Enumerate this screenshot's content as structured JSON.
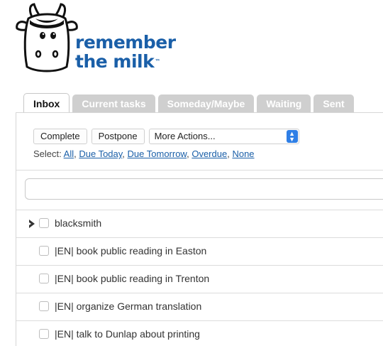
{
  "logo": {
    "brand_line1": "remember",
    "brand_line2": "the milk",
    "trademark": "™",
    "icon": "cow-icon"
  },
  "tabs": [
    {
      "label": "Inbox",
      "active": true
    },
    {
      "label": "Current tasks",
      "active": false
    },
    {
      "label": "Someday/Maybe",
      "active": false
    },
    {
      "label": "Waiting",
      "active": false
    },
    {
      "label": "Sent",
      "active": false
    }
  ],
  "toolbar": {
    "complete_label": "Complete",
    "postpone_label": "Postpone",
    "more_actions_value": "More Actions..."
  },
  "select_links": {
    "prefix": "Select:",
    "all": "All",
    "due_today": "Due Today",
    "due_tomorrow": "Due Tomorrow",
    "overdue": "Overdue",
    "none": "None"
  },
  "search": {
    "placeholder": "",
    "value": ""
  },
  "tasks": [
    {
      "label": "blacksmith",
      "expandable": true
    },
    {
      "label": "|EN| book public reading in Easton",
      "expandable": false
    },
    {
      "label": "|EN| book public reading in Trenton",
      "expandable": false
    },
    {
      "label": "|EN| organize German translation",
      "expandable": false
    },
    {
      "label": "|EN| talk to Dunlap about printing",
      "expandable": false
    }
  ],
  "colors": {
    "brand": "#1a5fa8",
    "tab_inactive": "#cfcfcf",
    "select_arrow": "#2f7fe6"
  }
}
